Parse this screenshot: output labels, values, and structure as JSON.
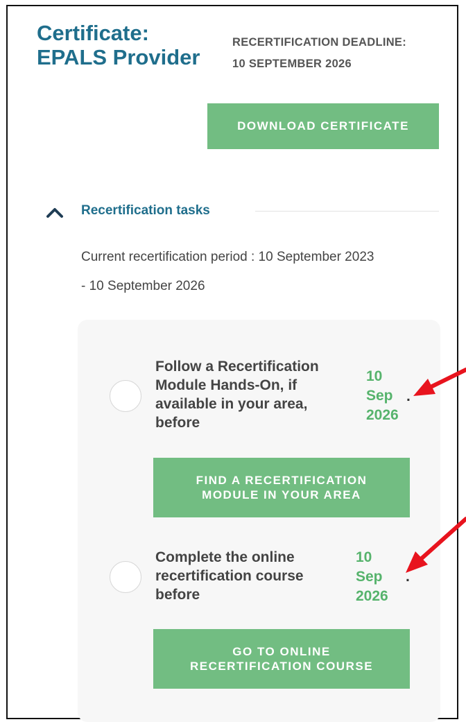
{
  "certificate": {
    "title_line1": "Certificate:",
    "title_line2": "EPALS Provider",
    "deadline_label": "RECERTIFICATION DEADLINE:",
    "deadline_date": "10 SEPTEMBER 2026",
    "download_label": "DOWNLOAD CERTIFICATE"
  },
  "recertification": {
    "section_title": "Recertification tasks",
    "period_line1": "Current recertification period : 10 September 2023",
    "period_line2": "- 10 September 2026",
    "tasks": [
      {
        "text_lines": [
          "Follow a Recertification",
          "Module Hands-On, if",
          "available in your area,",
          "before"
        ],
        "due_day": "10",
        "due_month": "Sep",
        "due_year": "2026",
        "period": ".",
        "button_line1": "FIND A RECERTIFICATION",
        "button_line2": "MODULE IN YOUR AREA"
      },
      {
        "text_lines": [
          "Complete the online",
          "recertification course",
          "before"
        ],
        "due_day": "10",
        "due_month": "Sep",
        "due_year": "2026",
        "period": ".",
        "button_line1": "GO TO ONLINE",
        "button_line2": "RECERTIFICATION COURSE"
      }
    ]
  },
  "icons": {
    "chevron": "chevron-up-icon",
    "annotation": "red-arrow-icon"
  },
  "colors": {
    "title_blue": "#1f6e8c",
    "button_green": "#72bd82",
    "date_green": "#56b36c",
    "annotation_red": "#e8141e"
  }
}
